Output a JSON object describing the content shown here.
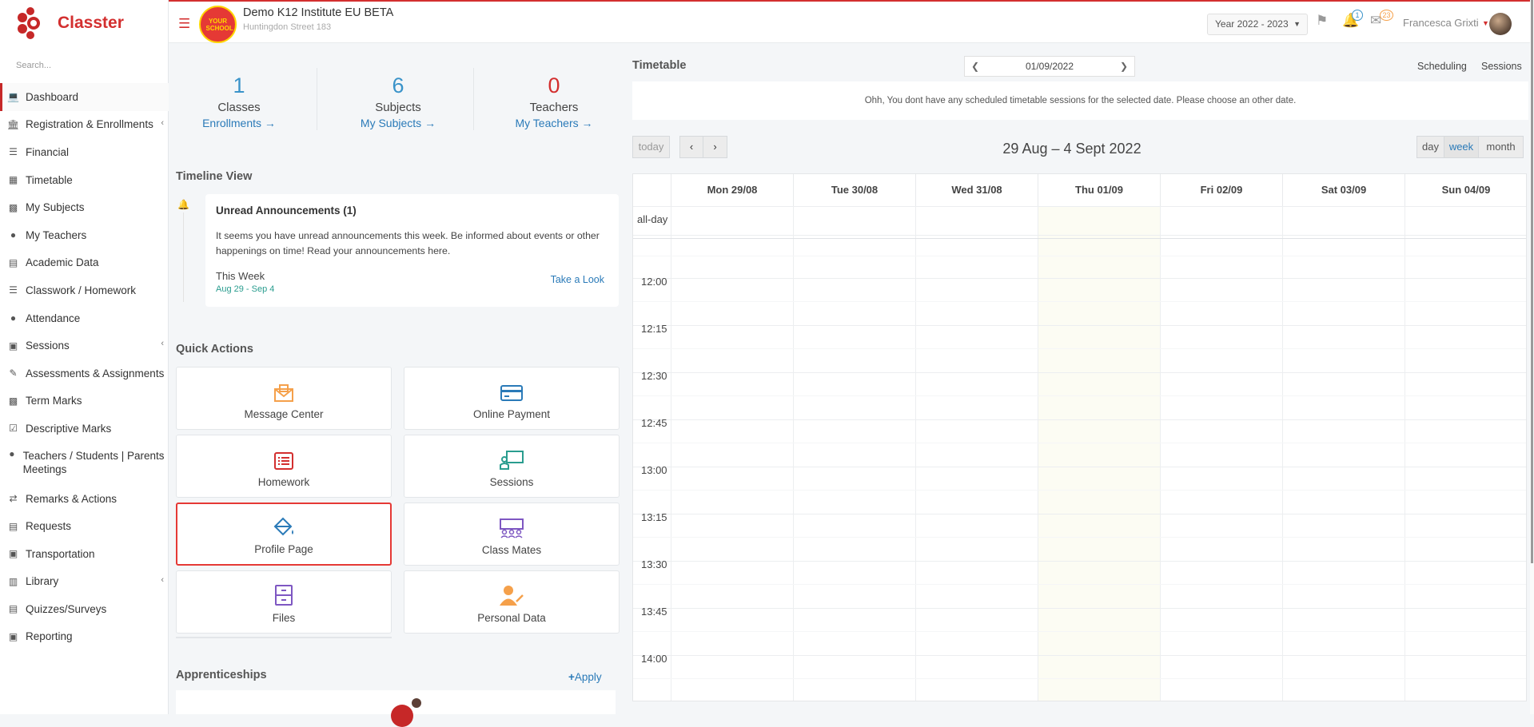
{
  "app": {
    "name": "Classter",
    "search_placeholder": "Search..."
  },
  "sidebar": {
    "items": [
      {
        "label": "Dashboard",
        "icon": "laptop-icon",
        "active": true
      },
      {
        "label": "Registration & Enrollments",
        "icon": "institution-icon",
        "chevron": true
      },
      {
        "label": "Financial",
        "icon": "coins-icon"
      },
      {
        "label": "Timetable",
        "icon": "calendar-icon"
      },
      {
        "label": "My Subjects",
        "icon": "book-icon"
      },
      {
        "label": "My Teachers",
        "icon": "users-icon"
      },
      {
        "label": "Academic Data",
        "icon": "id-card-icon"
      },
      {
        "label": "Classwork / Homework",
        "icon": "list-icon"
      },
      {
        "label": "Attendance",
        "icon": "user-check-icon"
      },
      {
        "label": "Sessions",
        "icon": "presentation-icon",
        "chevron": true
      },
      {
        "label": "Assessments & Assignments",
        "icon": "edit-icon"
      },
      {
        "label": "Term Marks",
        "icon": "book-closed-icon"
      },
      {
        "label": "Descriptive Marks",
        "icon": "checkbox-icon"
      },
      {
        "label": "Teachers / Students | Parents Meetings",
        "icon": "meeting-icon",
        "chevron": true
      },
      {
        "label": "Remarks & Actions",
        "icon": "shuffle-icon"
      },
      {
        "label": "Requests",
        "icon": "document-icon"
      },
      {
        "label": "Transportation",
        "icon": "bus-icon"
      },
      {
        "label": "Library",
        "icon": "library-icon",
        "chevron": true
      },
      {
        "label": "Quizzes/Surveys",
        "icon": "quiz-icon"
      },
      {
        "label": "Reporting",
        "icon": "printer-icon"
      }
    ]
  },
  "topbar": {
    "school_name": "Demo K12 Institute EU BETA",
    "school_address": "Huntingdon Street 183",
    "school_logo_text": "YOUR SCHOOL",
    "year": "Year 2022 - 2023",
    "notifications_count": "1",
    "messages_count": "23",
    "user_name": "Francesca Grixti"
  },
  "stats": [
    {
      "value": "1",
      "label": "Classes",
      "link": "Enrollments",
      "color": "#3a93c9"
    },
    {
      "value": "6",
      "label": "Subjects",
      "link": "My Subjects",
      "color": "#3a93c9"
    },
    {
      "value": "0",
      "label": "Teachers",
      "link": "My Teachers",
      "color": "#d32f2f"
    }
  ],
  "timeline": {
    "title": "Timeline View",
    "card_title": "Unread Announcements (1)",
    "card_text": "It seems you have unread announcements this week. Be informed about events or other happenings on time! Read your announcements here.",
    "period_label": "This Week",
    "period_range": "Aug 29 - Sep 4",
    "action": "Take a Look"
  },
  "quick_actions": {
    "title": "Quick Actions",
    "items": [
      {
        "label": "Message Center",
        "icon": "envelope-icon",
        "color": "#f5a04a"
      },
      {
        "label": "Online Payment",
        "icon": "credit-card-icon",
        "color": "#2a7ab8"
      },
      {
        "label": "Homework",
        "icon": "list-icon",
        "color": "#d32f2f"
      },
      {
        "label": "Sessions",
        "icon": "presentation-icon",
        "color": "#2a9d8f"
      },
      {
        "label": "Profile Page",
        "icon": "paint-bucket-icon",
        "color": "#2a7ab8",
        "selected": true
      },
      {
        "label": "Class Mates",
        "icon": "classmates-icon",
        "color": "#7e57c2"
      },
      {
        "label": "Files",
        "icon": "file-cabinet-icon",
        "color": "#7e57c2"
      },
      {
        "label": "Personal Data",
        "icon": "person-edit-icon",
        "color": "#f5a04a"
      }
    ]
  },
  "apprenticeships": {
    "title": "Apprenticeships",
    "apply": "Apply"
  },
  "timetable": {
    "title": "Timetable",
    "date": "01/09/2022",
    "scheduling": "Scheduling",
    "sessions": "Sessions",
    "notice": "Ohh, You dont have any scheduled timetable sessions for the selected date. Please choose an other date."
  },
  "calendar": {
    "today": "today",
    "range": "29 Aug – 4 Sept 2022",
    "views": [
      "day",
      "week",
      "month"
    ],
    "active_view": "week",
    "days": [
      "Mon 29/08",
      "Tue 30/08",
      "Wed 31/08",
      "Thu 01/09",
      "Fri 02/09",
      "Sat 03/09",
      "Sun 04/09"
    ],
    "allday": "all-day",
    "times": [
      "12:00",
      "12:15",
      "12:30",
      "12:45",
      "13:00",
      "13:15",
      "13:30",
      "13:45",
      "14:00"
    ]
  }
}
